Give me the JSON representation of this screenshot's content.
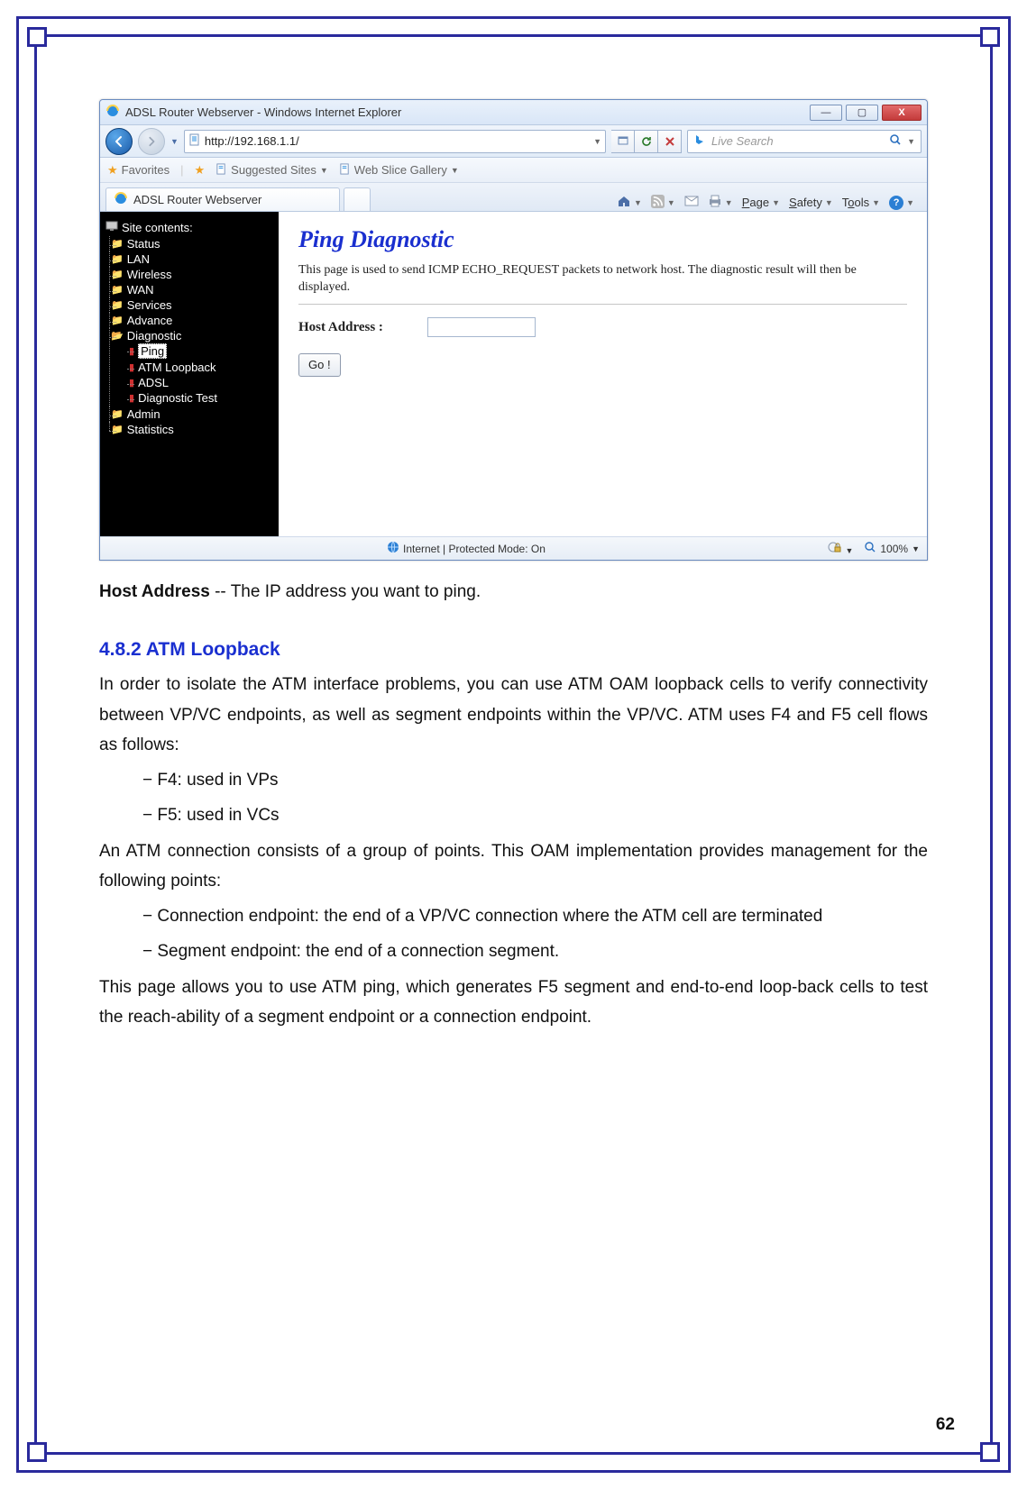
{
  "window": {
    "title": "ADSL Router Webserver - Windows Internet Explorer",
    "btn_min": "—",
    "btn_max": "▢",
    "btn_close": "X"
  },
  "nav": {
    "url": "http://192.168.1.1/",
    "refresh": "↻",
    "stop": "✕",
    "search_placeholder": "Live Search",
    "search_icon": "🔍"
  },
  "favbar": {
    "favorites": "Favorites",
    "suggested": "Suggested Sites",
    "webslice": "Web Slice Gallery"
  },
  "tab": {
    "label": "ADSL Router Webserver"
  },
  "cmdbar": {
    "page": "Page",
    "safety": "Safety",
    "tools": "Tools"
  },
  "sidebar": {
    "header": "Site contents:",
    "items": [
      {
        "label": "Status"
      },
      {
        "label": "LAN"
      },
      {
        "label": "Wireless"
      },
      {
        "label": "WAN"
      },
      {
        "label": "Services"
      },
      {
        "label": "Advance"
      },
      {
        "label": "Diagnostic",
        "open": true,
        "children": [
          {
            "label": "Ping",
            "selected": true
          },
          {
            "label": "ATM Loopback"
          },
          {
            "label": "ADSL"
          },
          {
            "label": "Diagnostic Test"
          }
        ]
      },
      {
        "label": "Admin"
      },
      {
        "label": "Statistics"
      }
    ]
  },
  "page": {
    "title": "Ping Diagnostic",
    "desc": "This page is used to send ICMP ECHO_REQUEST packets to network host. The diagnostic result will then be displayed.",
    "host_label": "Host Address :",
    "host_value": "",
    "go_label": "Go !"
  },
  "statusbar": {
    "zone": "Internet | Protected Mode: On",
    "zoom": "100%"
  },
  "doc": {
    "lead_strong": "Host Address",
    "lead_rest": " -- The IP address you want to ping.",
    "section_heading": "4.8.2 ATM Loopback",
    "p1": "In order to isolate the ATM interface problems, you can use ATM OAM loopback cells to verify connectivity between VP/VC endpoints, as well as segment endpoints within the VP/VC. ATM uses F4 and F5 cell flows as follows:",
    "b1": "− F4: used in VPs",
    "b2": "− F5: used in VCs",
    "p2": "An ATM connection consists of a group of points. This OAM implementation provides management for the following points:",
    "b3": "− Connection endpoint: the end of a VP/VC connection where the ATM cell are terminated",
    "b4": "− Segment endpoint: the end of a connection segment.",
    "p3": "This page allows you to use ATM ping, which generates F5 segment and end-to-end loop-back cells to test the reach-ability of a segment endpoint or a connection endpoint."
  },
  "page_number": "62"
}
